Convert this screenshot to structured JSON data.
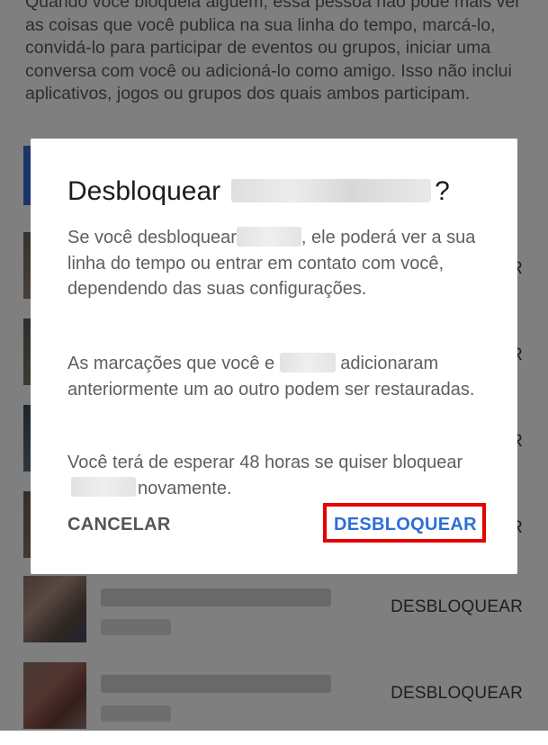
{
  "background": {
    "intro_text": "Quando você bloqueia alguém, essa pessoa não pode mais ver as coisas que você publica na sua linha do tempo, marcá-lo, convidá-lo para participar de eventos ou grupos, iniciar uma conversa com você ou adicioná-lo como amigo. Isso não inclui aplicativos, jogos ou grupos dos quais ambos participam.",
    "rows": [
      {
        "unblock_label": "DESBLOQUEAR"
      },
      {
        "unblock_label": "DESBLOQUEAR"
      }
    ]
  },
  "dialog": {
    "title_prefix": "Desbloquear",
    "title_suffix": "?",
    "p1_a": "Se você desbloquear",
    "p1_b": ", ele poderá ver a sua linha do tempo ou entrar em contato com você, dependendo das suas configurações.",
    "p2_a": "As marcações que você e",
    "p2_b": "adicionaram anteriormente um ao outro podem ser restauradas.",
    "p3_a": "Você terá de esperar 48 horas se quiser bloquear",
    "p3_b": "novamente.",
    "cancel_label": "CANCELAR",
    "unblock_label": "DESBLOQUEAR",
    "highlight_color": "#e60000",
    "accent_color": "#2d6fd6"
  }
}
